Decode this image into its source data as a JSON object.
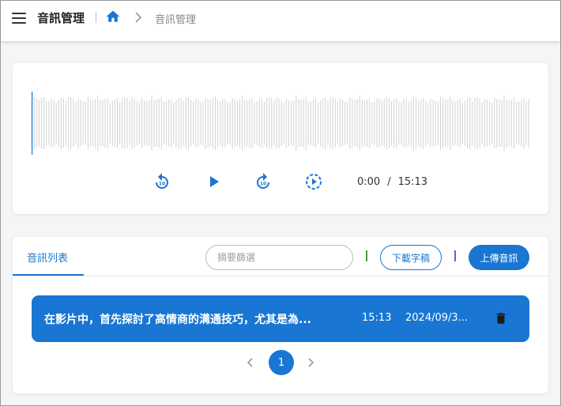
{
  "header": {
    "title": "音訊管理",
    "breadcrumb": "音訊管理"
  },
  "player": {
    "current_time": "0:00",
    "separator": "/",
    "total_time": "15:13"
  },
  "list": {
    "tab_label": "音訊列表",
    "search_placeholder": "摘要篩選",
    "download_label": "下載字稿",
    "upload_label": "上傳音訊",
    "items": [
      {
        "title": "在影片中，首先探討了高情商的溝通技巧，尤其是為...",
        "duration": "15:13",
        "date": "2024/09/3..."
      }
    ],
    "page": "1"
  },
  "colors": {
    "accent": "#1976d2",
    "waveform": "#d6d6d6"
  }
}
